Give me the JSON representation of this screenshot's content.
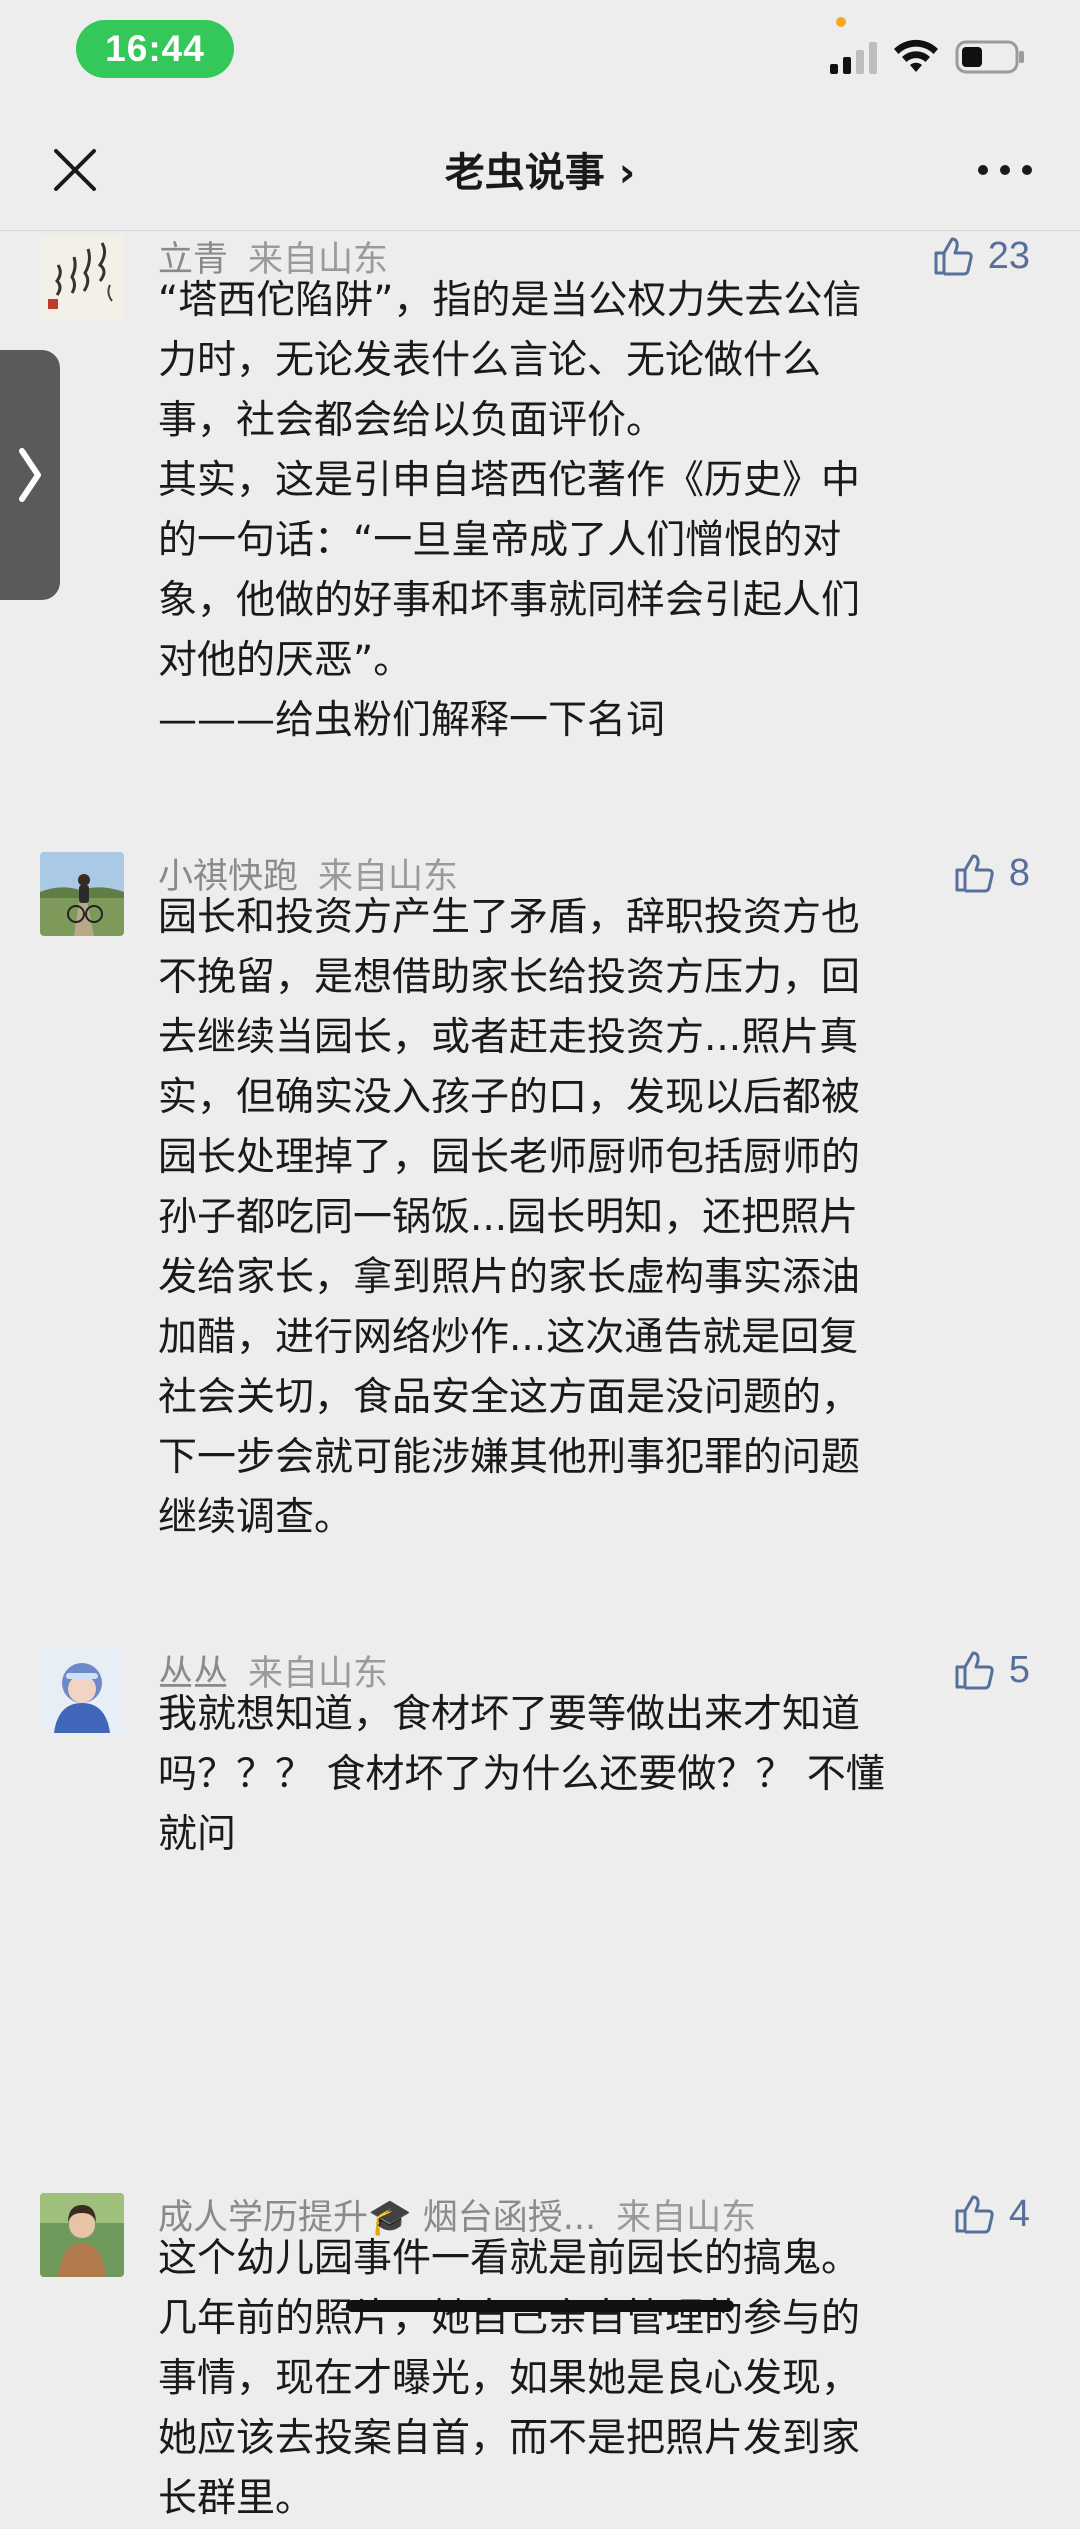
{
  "status_bar": {
    "time": "16:44"
  },
  "nav": {
    "title": "老虫说事 ›",
    "close_icon": "close-icon",
    "more_icon": "more-icon"
  },
  "side_tab": {
    "icon": "chevron-right-icon"
  },
  "comments": [
    {
      "author": "立青",
      "location": "来自山东",
      "likes": "23",
      "lines": [
        "“塔西佗陷阱”，指的是当公权力失去公信",
        "力时，无论发表什么言论、无论做什么",
        "事，社会都会给以负面评价。",
        "其实，这是引申自塔西佗著作《历史》中",
        "的一句话：“一旦皇帝成了人们憎恨的对",
        "象，他做的好事和坏事就同样会引起人们",
        "对他的厌恶”。",
        "———给虫粉们解释一下名词"
      ]
    },
    {
      "author": "小祺快跑",
      "location": "来自山东",
      "likes": "8",
      "lines": [
        "园长和投资方产生了矛盾，辞职投资方也",
        "不挽留，是想借助家长给投资方压力，回",
        "去继续当园长，或者赶走投资方...照片真",
        "实，但确实没入孩子的口，发现以后都被",
        "园长处理掉了，园长老师厨师包括厨师的",
        "孙子都吃同一锅饭...园长明知，还把照片",
        "发给家长，拿到照片的家长虚构事实添油",
        "加醋，进行网络炒作...这次通告就是回复",
        "社会关切，食品安全这方面是没问题的，",
        "下一步会就可能涉嫌其他刑事犯罪的问题",
        "继续调查。"
      ]
    },
    {
      "author": "丛丛",
      "location": "来自山东",
      "likes": "5",
      "lines": [
        "我就想知道，食材坏了要等做出来才知道",
        "吗？？？ 食材坏了为什么还要做？？ 不懂",
        "就问"
      ]
    },
    {
      "author": "成人学历提升🎓 烟台函授...",
      "location": "来自山东",
      "likes": "4",
      "lines": [
        "这个幼儿园事件一看就是前园长的搞鬼。",
        "几年前的照片，她自己亲自管理的参与的",
        "事情，现在才曝光，如果她是良心发现，",
        "她应该去投案自首，而不是把照片发到家",
        "长群里。"
      ]
    }
  ]
}
